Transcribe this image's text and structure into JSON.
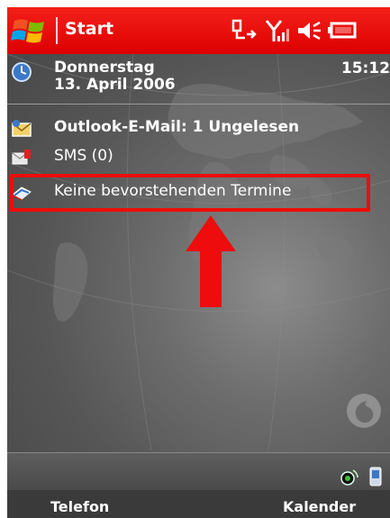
{
  "titlebar": {
    "title": "Start",
    "icons": [
      "windows-logo",
      "connectivity-icon",
      "signal-icon",
      "volume-icon",
      "battery-icon"
    ]
  },
  "today": {
    "date": {
      "line1": "Donnerstag",
      "line2": "13. April 2006",
      "time": "15:12"
    },
    "email": "Outlook-E-Mail: 1 Ungelesen",
    "sms": "SMS (0)",
    "calendar": "Keine bevorstehenden Termine"
  },
  "softkeys": {
    "left": "Telefon",
    "right": "Kalender"
  },
  "colors": {
    "titlebar": "#e60000",
    "highlight": "#ee0c0c",
    "arrow": "#ee0c0c"
  }
}
